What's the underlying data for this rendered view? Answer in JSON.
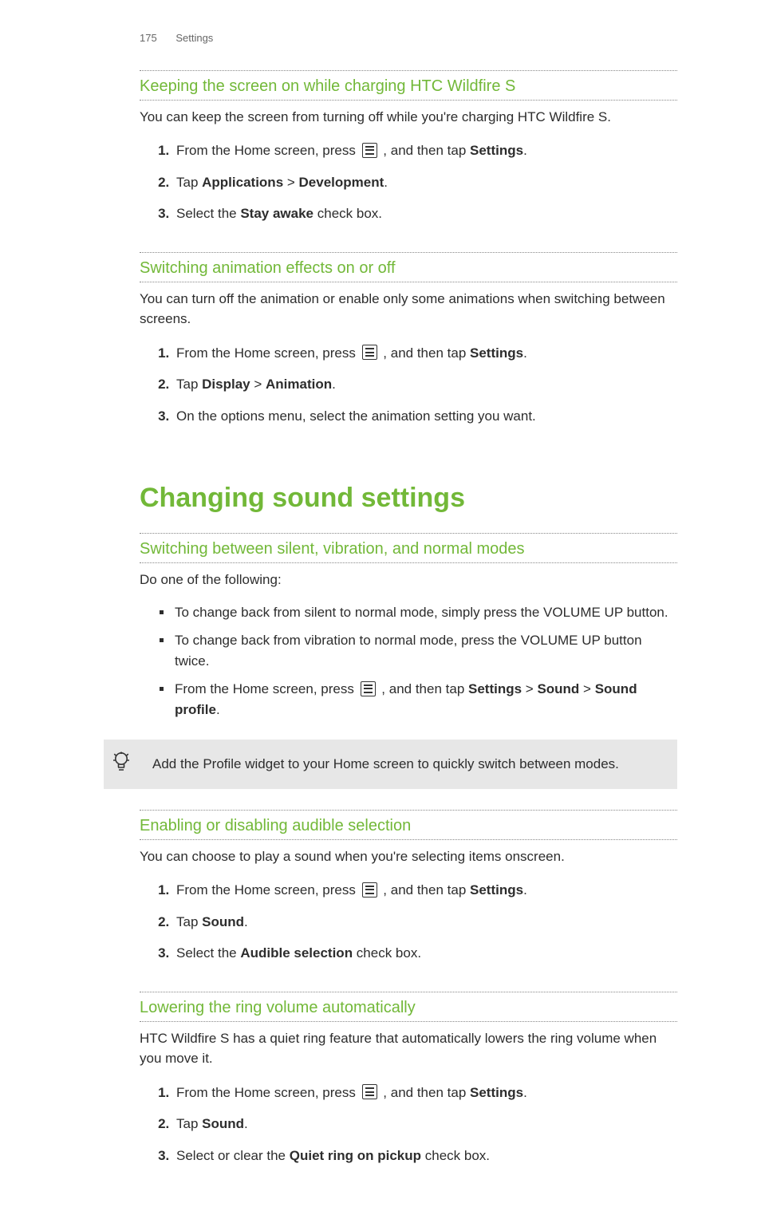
{
  "header": {
    "page_number": "175",
    "section": "Settings"
  },
  "sections": {
    "screen_on": {
      "title": "Keeping the screen on while charging HTC Wildfire S",
      "intro": "You can keep the screen from turning off while you're charging HTC Wildfire S.",
      "step1_a": "From the Home screen, press ",
      "step1_b": " , and then tap ",
      "step1_settings": "Settings",
      "step1_c": ".",
      "step2_a": "Tap ",
      "step2_apps": "Applications",
      "step2_gt": " > ",
      "step2_dev": "Development",
      "step2_b": ".",
      "step3_a": "Select the ",
      "step3_stay": "Stay awake",
      "step3_b": " check box."
    },
    "animation": {
      "title": "Switching animation effects on or off",
      "intro": "You can turn off the animation or enable only some animations when switching between screens.",
      "step1_a": "From the Home screen, press ",
      "step1_b": " , and then tap ",
      "step1_settings": "Settings",
      "step1_c": ".",
      "step2_a": "Tap ",
      "step2_display": "Display",
      "step2_gt": " > ",
      "step2_anim": "Animation",
      "step2_b": ".",
      "step3": "On the options menu, select the animation setting you want."
    },
    "chapter": "Changing sound settings",
    "modes": {
      "title": "Switching between silent, vibration, and normal modes",
      "intro": "Do one of the following:",
      "b1": "To change back from silent to normal mode, simply press the VOLUME UP button.",
      "b2": "To change back from vibration to normal mode, press the VOLUME UP button twice.",
      "b3_a": "From the Home screen, press ",
      "b3_b": " , and then tap ",
      "b3_settings": "Settings",
      "b3_gt1": " > ",
      "b3_sound": "Sound",
      "b3_gt2": " > ",
      "b3_profile": "Sound profile",
      "b3_c": "."
    },
    "tip": "Add the Profile widget to your Home screen to quickly switch between modes.",
    "audible": {
      "title": "Enabling or disabling audible selection",
      "intro": "You can choose to play a sound when you're selecting items onscreen.",
      "step1_a": "From the Home screen, press ",
      "step1_b": " , and then tap ",
      "step1_settings": "Settings",
      "step1_c": ".",
      "step2_a": "Tap ",
      "step2_sound": "Sound",
      "step2_b": ".",
      "step3_a": "Select the ",
      "step3_sel": "Audible selection",
      "step3_b": " check box."
    },
    "lowering": {
      "title": "Lowering the ring volume automatically",
      "intro": "HTC Wildfire S has a quiet ring feature that automatically lowers the ring volume when you move it.",
      "step1_a": "From the Home screen, press ",
      "step1_b": " , and then tap ",
      "step1_settings": "Settings",
      "step1_c": ".",
      "step2_a": "Tap ",
      "step2_sound": "Sound",
      "step2_b": ".",
      "step3_a": "Select or clear the ",
      "step3_quiet": "Quiet ring on pickup",
      "step3_b": " check box."
    }
  }
}
